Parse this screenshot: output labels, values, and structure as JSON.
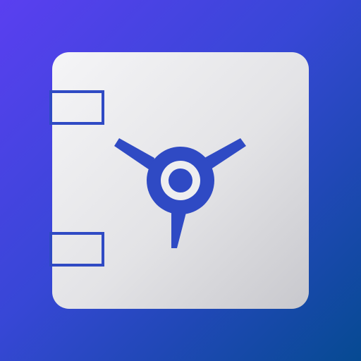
{
  "icon": {
    "name": "safe-vault-icon",
    "colors": {
      "background_start": "#5a3ff0",
      "background_end": "#064a92",
      "safe_body_light": "#f4f4f6",
      "safe_body_dark": "#c7c7cc",
      "dial_blue": "#2f4ac4"
    }
  }
}
